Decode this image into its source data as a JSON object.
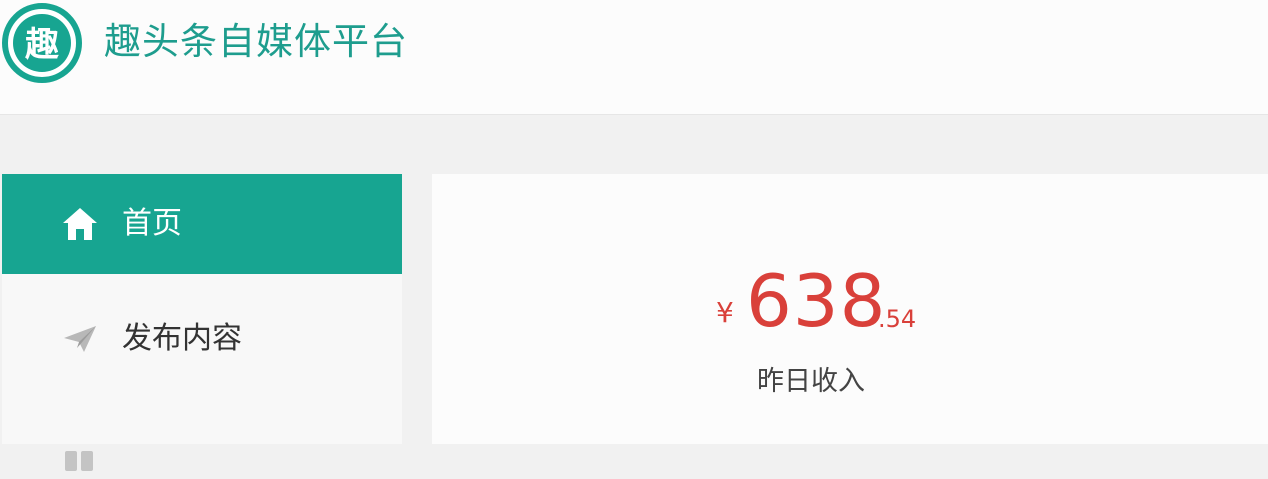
{
  "header": {
    "logo_glyph": "趣",
    "title": "趣头条自媒体平台"
  },
  "sidebar": {
    "items": [
      {
        "label": "首页",
        "icon": "home-icon",
        "active": true
      },
      {
        "label": "发布内容",
        "icon": "paper-plane-icon",
        "active": false
      },
      {
        "label": "",
        "icon": "quote-icon",
        "active": false
      }
    ]
  },
  "income": {
    "currency": "¥",
    "amount_integer": "638",
    "amount_decimal": ".54",
    "label": "昨日收入"
  },
  "colors": {
    "brand": "#17a591",
    "income": "#d9403a",
    "title": "#1e9d8e"
  }
}
